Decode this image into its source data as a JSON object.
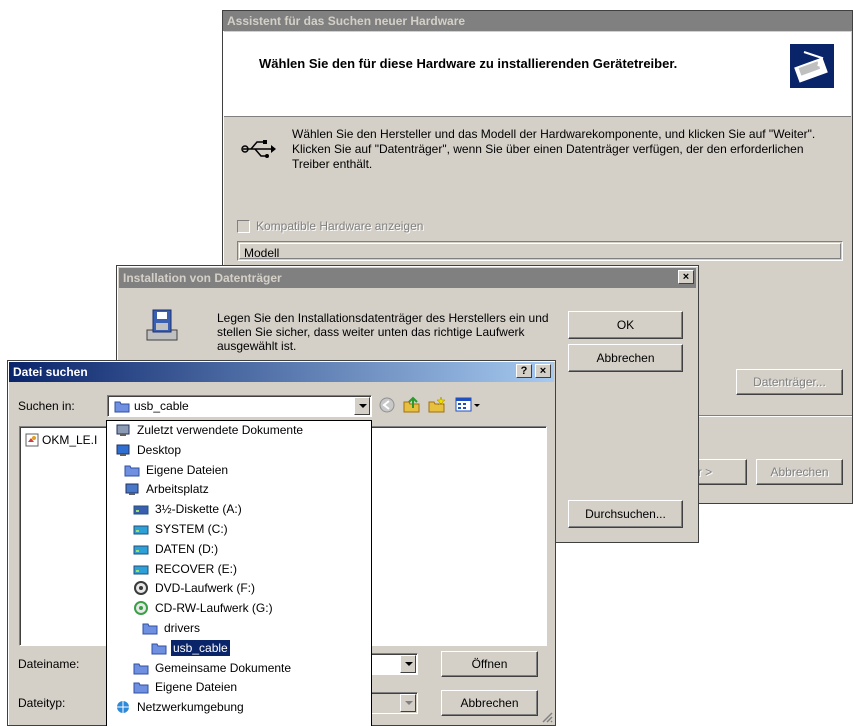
{
  "wizard": {
    "title": "Assistent für das Suchen neuer Hardware",
    "heading": "Wählen Sie den für diese Hardware zu installierenden Gerätetreiber.",
    "instructions": "Wählen Sie den Hersteller und das Modell der Hardwarekomponente, und klicken Sie auf \"Weiter\". Klicken Sie auf \"Datenträger\", wenn Sie über einen Datenträger verfügen, der den erforderlichen Treiber enthält.",
    "compatible_checkbox": "Kompatible Hardware anzeigen",
    "model_header": "Modell",
    "disk_button": "Datenträger...",
    "next_button": "r >",
    "cancel_button": "Abbrechen"
  },
  "install_disk": {
    "title": "Installation von Datenträger",
    "close": "×",
    "message": "Legen Sie den Installationsdatenträger des Herstellers ein und stellen Sie sicher, dass weiter unten das richtige Laufwerk ausgewählt ist.",
    "ok_button": "OK",
    "cancel_button": "Abbrechen",
    "browse_button": "Durchsuchen..."
  },
  "file_dialog": {
    "title": "Datei suchen",
    "help": "?",
    "close": "×",
    "look_in_label": "Suchen in:",
    "look_in_value": "usb_cable",
    "file_item": "OKM_LE.I",
    "filename_label": "Dateiname:",
    "filetype_label": "Dateityp:",
    "open_button": "Öffnen",
    "cancel_button": "Abbrechen"
  },
  "dropdown": {
    "items": [
      {
        "label": "Zuletzt verwendete Dokumente",
        "icon": "recent-icon",
        "color": "#8a9bb3"
      },
      {
        "label": "Desktop",
        "icon": "desktop-icon",
        "color": "#2e6fd1"
      },
      {
        "label": "Eigene Dateien",
        "icon": "folder-icon",
        "color": "#6f8fe0"
      },
      {
        "label": "Arbeitsplatz",
        "icon": "computer-icon",
        "color": "#4a78c8"
      },
      {
        "label": "3½-Diskette (A:)",
        "icon": "floppy-icon",
        "color": "#3a5fb0"
      },
      {
        "label": "SYSTEM (C:)",
        "icon": "drive-icon",
        "color": "#2ea0d8"
      },
      {
        "label": "DATEN (D:)",
        "icon": "drive-icon",
        "color": "#2ea0d8"
      },
      {
        "label": "RECOVER (E:)",
        "icon": "drive-icon",
        "color": "#2ea0d8"
      },
      {
        "label": "DVD-Laufwerk (F:)",
        "icon": "dvd-icon",
        "color": "#3a3a3a"
      },
      {
        "label": "CD-RW-Laufwerk (G:)",
        "icon": "cd-icon",
        "color": "#3aa048"
      },
      {
        "label": "drivers",
        "icon": "folder-open-icon",
        "color": "#6f8fe0"
      },
      {
        "label": "usb_cable",
        "icon": "folder-open-icon",
        "color": "#6f8fe0"
      },
      {
        "label": "Gemeinsame Dokumente",
        "icon": "shared-folder-icon",
        "color": "#6f8fe0"
      },
      {
        "label": "Eigene Dateien",
        "icon": "folder-icon",
        "color": "#6f8fe0"
      },
      {
        "label": "Netzwerkumgebung",
        "icon": "network-icon",
        "color": "#2e8ad8"
      }
    ]
  }
}
